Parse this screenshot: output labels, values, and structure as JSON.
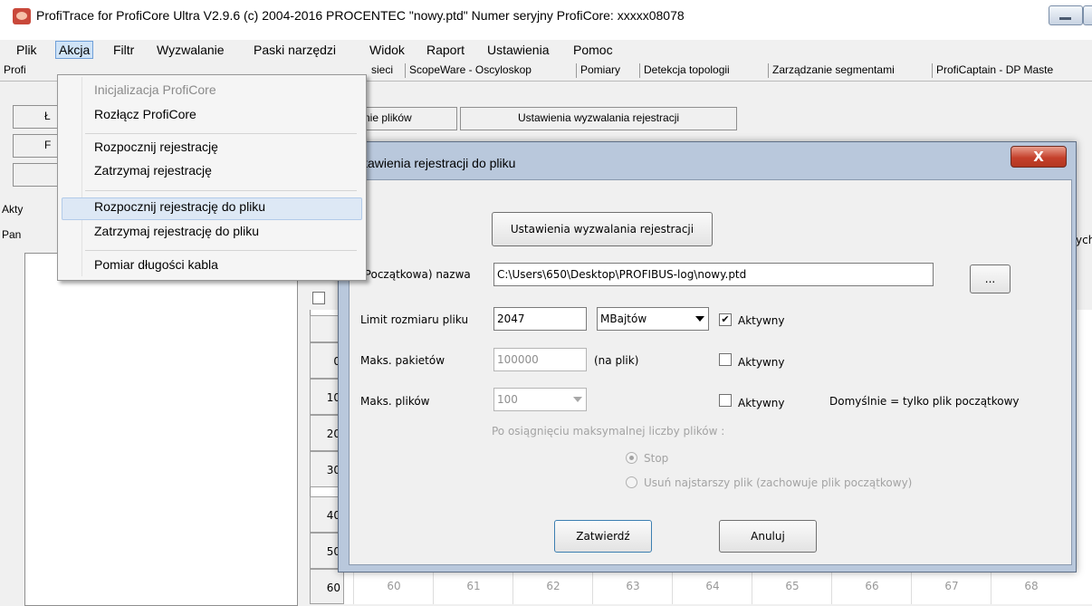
{
  "window": {
    "title": "ProfiTrace for ProfiCore Ultra V2.9.6 (c) 2004-2016 PROCENTEC  \"nowy.ptd\"  Numer seryjny ProfiCore: xxxxx08078"
  },
  "menubar": {
    "items": [
      "Plik",
      "Akcja",
      "Filtr",
      "Wyzwalanie",
      "Paski narzędzi",
      "Widok",
      "Raport",
      "Ustawienia",
      "Pomoc"
    ]
  },
  "tabs": [
    "Profi",
    "sieci",
    "ScopeWare - Oscyloskop",
    "Pomiary",
    "Detekcja topologii",
    "Zarządzanie segmentami",
    "ProfiCaptain - DP Maste"
  ],
  "background": {
    "btn_pliki": "nie plików",
    "btn_trigger": "Ustawienia wyzwalania rejestracji",
    "left_labels": [
      "Ł",
      "F",
      "Akty",
      "Pan"
    ],
    "cut_right": "ych",
    "row_headers": [
      "0",
      "10",
      "20",
      "30",
      "40",
      "50",
      "60"
    ],
    "last_row_cells": [
      "60",
      "61",
      "62",
      "63",
      "64",
      "65",
      "66",
      "67",
      "68"
    ]
  },
  "dropdown": {
    "items": [
      {
        "label": "Inicjalizacja ProfiCore",
        "disabled": true
      },
      {
        "label": "Rozłącz ProfiCore",
        "disabled": false
      },
      {
        "label": "Rozpocznij rejestrację",
        "disabled": false
      },
      {
        "label": "Zatrzymaj rejestrację",
        "disabled": false
      },
      {
        "label": "Rozpocznij rejestrację do pliku",
        "disabled": false,
        "highlighted": true
      },
      {
        "label": "Zatrzymaj rejestrację do pliku",
        "disabled": false
      },
      {
        "label": "Pomiar długości kabla",
        "disabled": false
      }
    ]
  },
  "dialog": {
    "title": "Ustawienia rejestracji do pliku",
    "close_label": "X",
    "trigger_button": "Ustawienia wyzwalania rejestracji",
    "name_label": "(Początkowa) nazwa",
    "name_value": "C:\\Users\\650\\Desktop\\PROFIBUS-log\\nowy.ptd",
    "browse_label": "...",
    "size_label": "Limit rozmiaru pliku",
    "size_value": "2047",
    "size_unit": "MBajtów",
    "size_active_label": "Aktywny",
    "size_active": true,
    "packets_label": "Maks. pakietów",
    "packets_value": "100000",
    "packets_unit": "(na plik)",
    "packets_active_label": "Aktywny",
    "packets_active": false,
    "files_label": "Maks. plików",
    "files_value": "100",
    "files_active_label": "Aktywny",
    "files_active": false,
    "default_note": "Domyślnie = tylko plik początkowy",
    "after_max_label": "Po osiągnięciu maksymalnej liczby plików :",
    "radio_stop": "Stop",
    "radio_delete": "Usuń najstarszy plik (zachowuje plik początkowy)",
    "confirm_button": "Zatwierdź",
    "cancel_button": "Anuluj"
  }
}
